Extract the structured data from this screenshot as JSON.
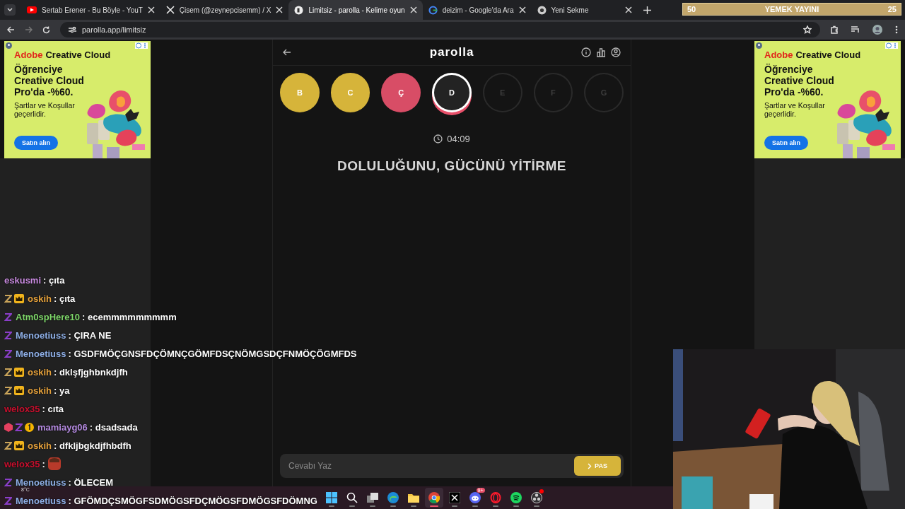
{
  "browser": {
    "tabs": [
      {
        "title": "Sertab Erener - Bu Böyle - YouT",
        "selected": false
      },
      {
        "title": "Çisem (@zeynepcisemm) / X",
        "selected": false
      },
      {
        "title": "Limitsiz - parolla - Kelime oyun",
        "selected": true
      },
      {
        "title": "deizim - Google'da Ara",
        "selected": false
      },
      {
        "title": "Yeni Sekme",
        "selected": false
      }
    ],
    "url": "parolla.app/limitsiz"
  },
  "goal_bar": {
    "current": "50",
    "title": "YEMEK YAYINI",
    "target": "25"
  },
  "ads": [
    {
      "brand_mark": "Adobe",
      "brand": "Creative Cloud",
      "headline": "Öğrenciye Creative Cloud Pro'da -%60.",
      "terms": "Şartlar ve Koşullar geçerlidir.",
      "button": "Satın alın"
    },
    {
      "brand_mark": "Adobe",
      "brand": "Creative Cloud",
      "headline": "Öğrenciye Creative Cloud Pro'da -%60.",
      "terms": "Şartlar ve Koşullar geçerlidir.",
      "button": "Satın alın"
    }
  ],
  "game": {
    "title": "parolla",
    "letters": [
      {
        "letter": "B",
        "kind": "passed"
      },
      {
        "letter": "C",
        "kind": "passed"
      },
      {
        "letter": "Ç",
        "kind": "wrong"
      },
      {
        "letter": "D",
        "kind": "current"
      },
      {
        "letter": "E",
        "kind": "pending"
      },
      {
        "letter": "F",
        "kind": "pending"
      },
      {
        "letter": "G",
        "kind": "pending"
      }
    ],
    "timer": "04:09",
    "question": "DOLULUĞUNU, GÜCÜNÜ YİTİRME",
    "answer": {
      "placeholder": "Cevabı Yaz"
    },
    "pass_button": "PAS"
  },
  "chat": [
    {
      "user": "eskusmi",
      "color": "#c98be0",
      "text": ": çıta"
    },
    {
      "user": "oskih",
      "color": "#e8a33c",
      "badges": [
        {
          "kind": "z-gold"
        },
        {
          "kind": "crown"
        }
      ],
      "text": ": çıta"
    },
    {
      "user": "Atm0spHere10",
      "color": "#7fd86a",
      "badges": [
        {
          "kind": "z-purple"
        }
      ],
      "text": ": ecemmmmmmmmm"
    },
    {
      "user": "Menoetiuss",
      "color": "#8fb0e8",
      "badges": [
        {
          "kind": "z-purple"
        }
      ],
      "text": ": ÇIRA NE"
    },
    {
      "user": "Menoetiuss",
      "color": "#8fb0e8",
      "badges": [
        {
          "kind": "z-purple"
        }
      ],
      "text": ": GSDFMÖÇGNSFDÇÖMNÇGÖMFDSÇNÖMGSDÇFNMÖÇÖGMFDS"
    },
    {
      "user": "oskih",
      "color": "#e8a33c",
      "badges": [
        {
          "kind": "z-gold"
        },
        {
          "kind": "crown"
        }
      ],
      "text": ": dklşfjghbnkdjfh"
    },
    {
      "user": "oskih",
      "color": "#e8a33c",
      "badges": [
        {
          "kind": "z-gold"
        },
        {
          "kind": "crown"
        }
      ],
      "text": ": ya"
    },
    {
      "user": "welox35",
      "color": "#c8102e",
      "text": ": cıta"
    },
    {
      "user": "mamiayg06",
      "color": "#b48ae0",
      "badges": [
        {
          "kind": "gem"
        },
        {
          "kind": "z-purple"
        },
        {
          "kind": "one"
        }
      ],
      "text": ": dsadsada"
    },
    {
      "user": "oskih",
      "color": "#e8a33c",
      "badges": [
        {
          "kind": "z-gold"
        },
        {
          "kind": "crown"
        }
      ],
      "text": ": dfkljbgkdjfhbdfh"
    },
    {
      "user": "welox35",
      "color": "#c8102e",
      "text": ":",
      "emote": true
    },
    {
      "user": "Menoetiuss",
      "color": "#8fb0e8",
      "badges": [
        {
          "kind": "z-purple"
        }
      ],
      "text": ": ÖLECEM"
    },
    {
      "user": "Menoetiuss",
      "color": "#8fb0e8",
      "badges": [
        {
          "kind": "z-purple"
        }
      ],
      "text": ": GFÖMDÇSMÖGFSDMÖGSFDÇMÖGSFDMÖGSFDÖMNG"
    }
  ],
  "taskbar": {
    "weather": "8°C",
    "apps": [
      {
        "active": false
      },
      {
        "active": false
      },
      {
        "active": false
      },
      {
        "active": false
      },
      {
        "active": false
      },
      {
        "active": true
      },
      {
        "active": false
      },
      {
        "active": false,
        "badge": "9+"
      },
      {
        "active": false
      },
      {
        "active": false
      },
      {
        "active": false,
        "dot": true
      }
    ]
  }
}
